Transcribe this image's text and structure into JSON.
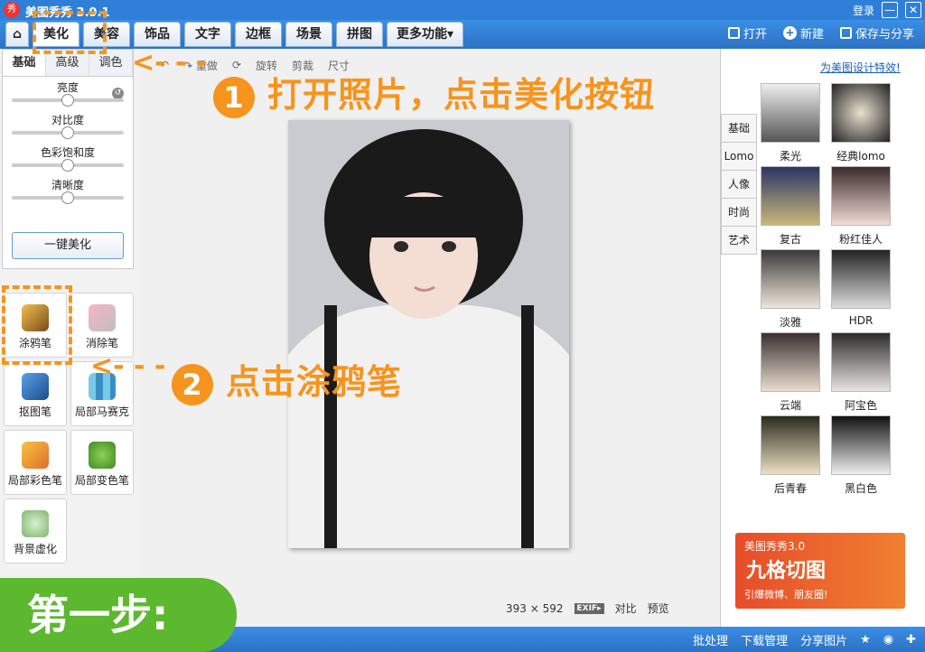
{
  "titlebar": {
    "logo": "秀",
    "title": "美图秀秀 3.9.1",
    "login": "登录",
    "minimize": "—",
    "close": "✕"
  },
  "nav": {
    "tabs": [
      "美化",
      "美容",
      "饰品",
      "文字",
      "边框",
      "场景",
      "拼图",
      "更多功能▾"
    ],
    "open": "打开",
    "new": "新建",
    "save": "保存与分享"
  },
  "left": {
    "subtabs": [
      "基础",
      "高级",
      "调色"
    ],
    "sliders": [
      {
        "label": "亮度",
        "level": 0.5
      },
      {
        "label": "对比度",
        "level": 0.5
      },
      {
        "label": "色彩饱和度",
        "level": 0.5
      },
      {
        "label": "清晰度",
        "level": 0.5
      }
    ],
    "onekey": "一键美化",
    "tools": [
      "涂鸦笔",
      "消除笔",
      "抠图笔",
      "局部马赛克",
      "局部彩色笔",
      "局部变色笔",
      "背景虚化"
    ]
  },
  "toolbar2": [
    "↶",
    "↷ 重做",
    "⟳",
    "旋转",
    "剪裁",
    "尺寸"
  ],
  "status": {
    "size": "393 × 592",
    "exif": "EXIF▸",
    "compare": "对比",
    "preview": "预览"
  },
  "right": {
    "link": "为美图设计特效!",
    "tabs": [
      "基础",
      "Lomo",
      "人像",
      "时尚",
      "艺术"
    ],
    "filters": [
      "柔光",
      "经典lomo",
      "复古",
      "粉红佳人",
      "淡雅",
      "HDR",
      "云端",
      "阿宝色",
      "后青春",
      "黑白色"
    ],
    "ad": {
      "line1": "美图秀秀3.0",
      "line2": "九格切图",
      "line3": "引爆微博、朋友圈!"
    }
  },
  "bottom": {
    "batch": "批处理",
    "download": "下载管理",
    "share": "分享图片"
  },
  "annotations": {
    "num1": "1",
    "step1": "打开照片，点击美化按钮",
    "num2": "2",
    "step2": "点击涂鸦笔",
    "step_pill": "第一步:"
  },
  "colors": {
    "accent": "#f7941d",
    "green": "#5cb82e",
    "blue": "#2c72c4"
  }
}
